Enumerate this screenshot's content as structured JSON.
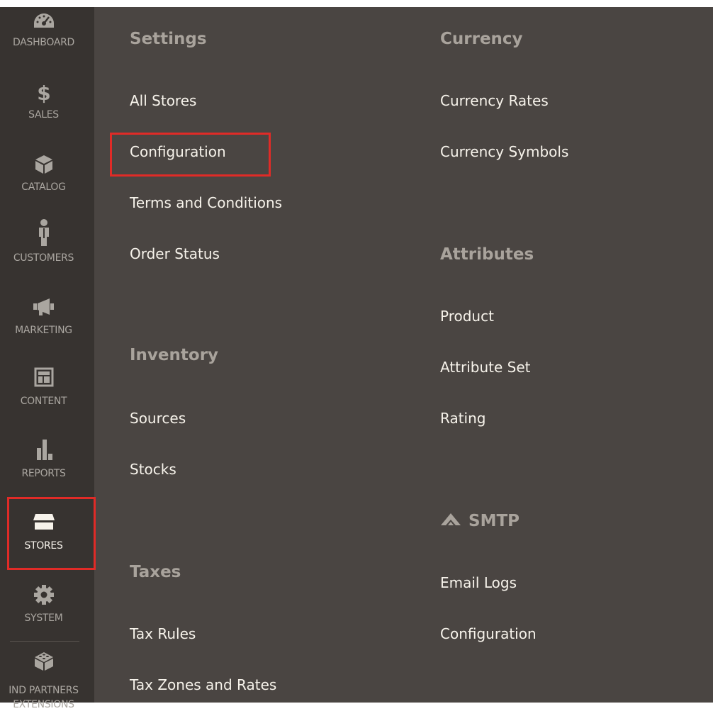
{
  "sidebar": {
    "items": [
      {
        "key": "dashboard",
        "label": "DASHBOARD",
        "icon": "dashboard-icon"
      },
      {
        "key": "sales",
        "label": "SALES",
        "icon": "dollar-icon"
      },
      {
        "key": "catalog",
        "label": "CATALOG",
        "icon": "box-icon"
      },
      {
        "key": "customers",
        "label": "CUSTOMERS",
        "icon": "person-icon"
      },
      {
        "key": "marketing",
        "label": "MARKETING",
        "icon": "megaphone-icon"
      },
      {
        "key": "content",
        "label": "CONTENT",
        "icon": "layout-icon"
      },
      {
        "key": "reports",
        "label": "REPORTS",
        "icon": "bar-chart-icon"
      },
      {
        "key": "stores",
        "label": "STORES",
        "icon": "storefront-icon",
        "active": true
      },
      {
        "key": "system",
        "label": "SYSTEM",
        "icon": "gear-icon"
      },
      {
        "key": "partners",
        "label": "IND PARTNERS",
        "label_line2": "EXTENSIONS",
        "icon": "blocks-icon"
      }
    ]
  },
  "stores_menu": {
    "settings": {
      "title": "Settings",
      "links": [
        "All Stores",
        "Configuration",
        "Terms and Conditions",
        "Order Status"
      ]
    },
    "inventory": {
      "title": "Inventory",
      "links": [
        "Sources",
        "Stocks"
      ]
    },
    "taxes": {
      "title": "Taxes",
      "links": [
        "Tax Rules",
        "Tax Zones and Rates"
      ]
    },
    "currency": {
      "title": "Currency",
      "links": [
        "Currency Rates",
        "Currency Symbols"
      ]
    },
    "attributes": {
      "title": "Attributes",
      "links": [
        "Product",
        "Attribute Set",
        "Rating"
      ]
    },
    "smtp": {
      "title": "SMTP",
      "icon": "smtp-logo-icon",
      "links": [
        "Email Logs",
        "Configuration"
      ]
    }
  },
  "colors": {
    "sidebar_bg": "#373330",
    "panel_bg": "#4a4542",
    "highlight": "#e02b27",
    "link_text": "#f7f3eb",
    "section_title": "#a9a39c",
    "sidebar_label": "#aaa6a0"
  }
}
